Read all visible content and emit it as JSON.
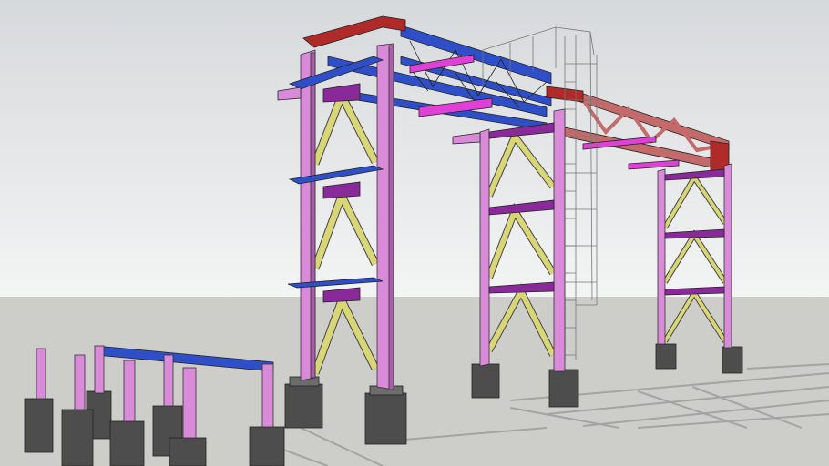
{
  "scene": {
    "colors": {
      "sky_top": "#d9dcde",
      "sky_horizon": "#f4f5f5",
      "ground": "#cdcdc9",
      "column": "#d98ad9",
      "column_dark": "#a85ea8",
      "brace": "#d8d676",
      "beam_blue": "#2f4fc9",
      "beam_red": "#b02a2a",
      "truss_salmon": "#c56a6a",
      "magenta": "#e040d8",
      "purple": "#8a2a9a",
      "footing": "#4d4d4d",
      "footing_top": "#6c6c6c",
      "cage": "#777777",
      "shadow": "#9a9a98"
    }
  }
}
